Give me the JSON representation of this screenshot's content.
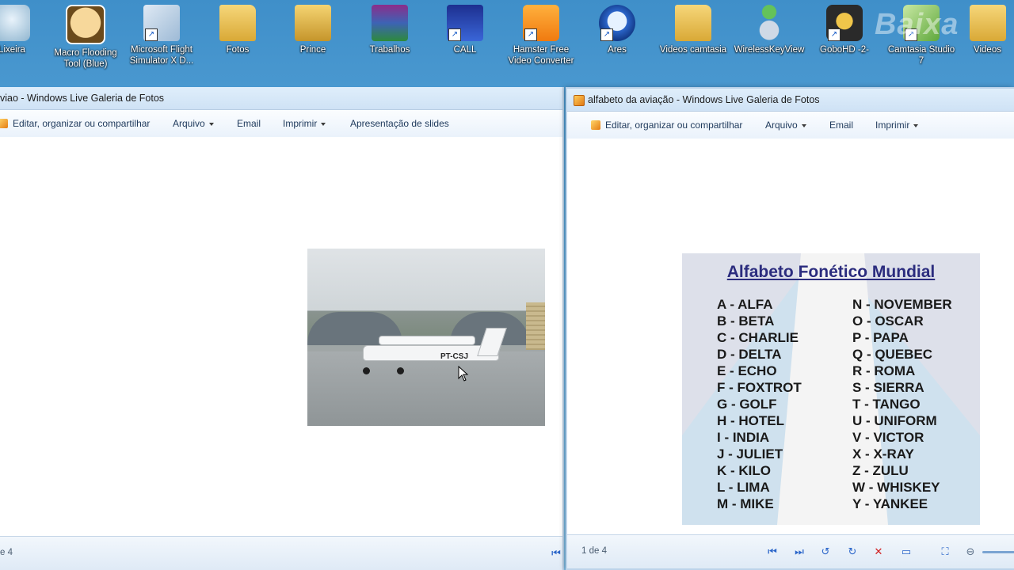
{
  "desktop": {
    "icons": [
      {
        "label": "Lixeira",
        "icon": "recycle-bin-icon"
      },
      {
        "label": "Macro Flooding Tool (Blue)",
        "icon": "cartoon-face-icon"
      },
      {
        "label": "Microsoft Flight Simulator X D...",
        "icon": "flight-simulator-icon"
      },
      {
        "label": "Fotos",
        "icon": "folder-icon"
      },
      {
        "label": "Prince",
        "icon": "folder-icon"
      },
      {
        "label": "Trabalhos",
        "icon": "winrar-icon"
      },
      {
        "label": "CALL",
        "icon": "call-app-icon"
      },
      {
        "label": "Hamster Free Video Converter",
        "icon": "hamster-icon"
      },
      {
        "label": "Ares",
        "icon": "ares-icon"
      },
      {
        "label": "Videos camtasia",
        "icon": "folder-icon"
      },
      {
        "label": "WirelessKeyView",
        "icon": "wifi-key-icon"
      },
      {
        "label": "GoboHD -2-",
        "icon": "gobo-icon"
      },
      {
        "label": "Camtasia Studio 7",
        "icon": "camtasia-icon"
      },
      {
        "label": "Videos",
        "icon": "folder-icon"
      }
    ],
    "watermark": "Baixa"
  },
  "left_window": {
    "title": "viao - Windows Live Galeria de Fotos",
    "menu": {
      "edit": "Editar, organizar ou compartilhar",
      "file": "Arquivo",
      "email": "Email",
      "print": "Imprimir",
      "slideshow": "Apresentação de slides"
    },
    "photo": {
      "registration": "PT-CSJ"
    },
    "status": {
      "pages": "e 4"
    }
  },
  "right_window": {
    "title": "alfabeto da aviação - Windows Live Galeria de Fotos",
    "menu": {
      "edit": "Editar, organizar ou compartilhar",
      "file": "Arquivo",
      "email": "Email",
      "print": "Imprimir"
    },
    "phonetic": {
      "title": "Alfabeto Fonético Mundial",
      "left_column": [
        "A - ALFA",
        "B - BETA",
        "C - CHARLIE",
        "D - DELTA",
        "E - ECHO",
        "F - FOXTROT",
        "G - GOLF",
        "H - HOTEL",
        "I - INDIA",
        "J - JULIET",
        "K - KILO",
        "L - LIMA",
        "M - MIKE"
      ],
      "right_column": [
        "N - NOVEMBER",
        "O - OSCAR",
        "P - PAPA",
        "Q - QUEBEC",
        "R - ROMA",
        "S - SIERRA",
        "T - TANGO",
        "U - UNIFORM",
        "V - VICTOR",
        "X - X-RAY",
        "Z - ZULU",
        "W - WHISKEY",
        "Y - YANKEE"
      ]
    },
    "status": {
      "pages": "1 de 4"
    }
  }
}
